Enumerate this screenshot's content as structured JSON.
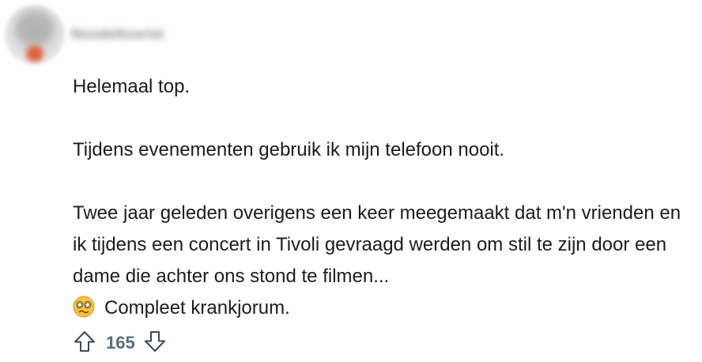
{
  "comment": {
    "author": "Noodeltoorist",
    "paragraphs": [
      "Helemaal top.",
      "Tijdens evenementen gebruik ik mijn telefoon nooit.",
      "Twee jaar geleden overigens een keer meegemaakt dat m'n vrienden en ik tijdens een concert in Tivoli gevraagd werden om stil te zijn door een dame die achter ons stond te filmen..."
    ],
    "last_line_emoji": "dizzy-face-emoji",
    "last_line_text": "Compleet krankjorum.",
    "score": "165"
  },
  "icons": {
    "upvote": "upvote-arrow-icon",
    "downvote": "downvote-arrow-icon"
  },
  "colors": {
    "text": "#1c1c1c",
    "vote_gray": "#576f76",
    "avatar_accent": "#e0603a",
    "emoji_yellow": "#f6c142"
  }
}
